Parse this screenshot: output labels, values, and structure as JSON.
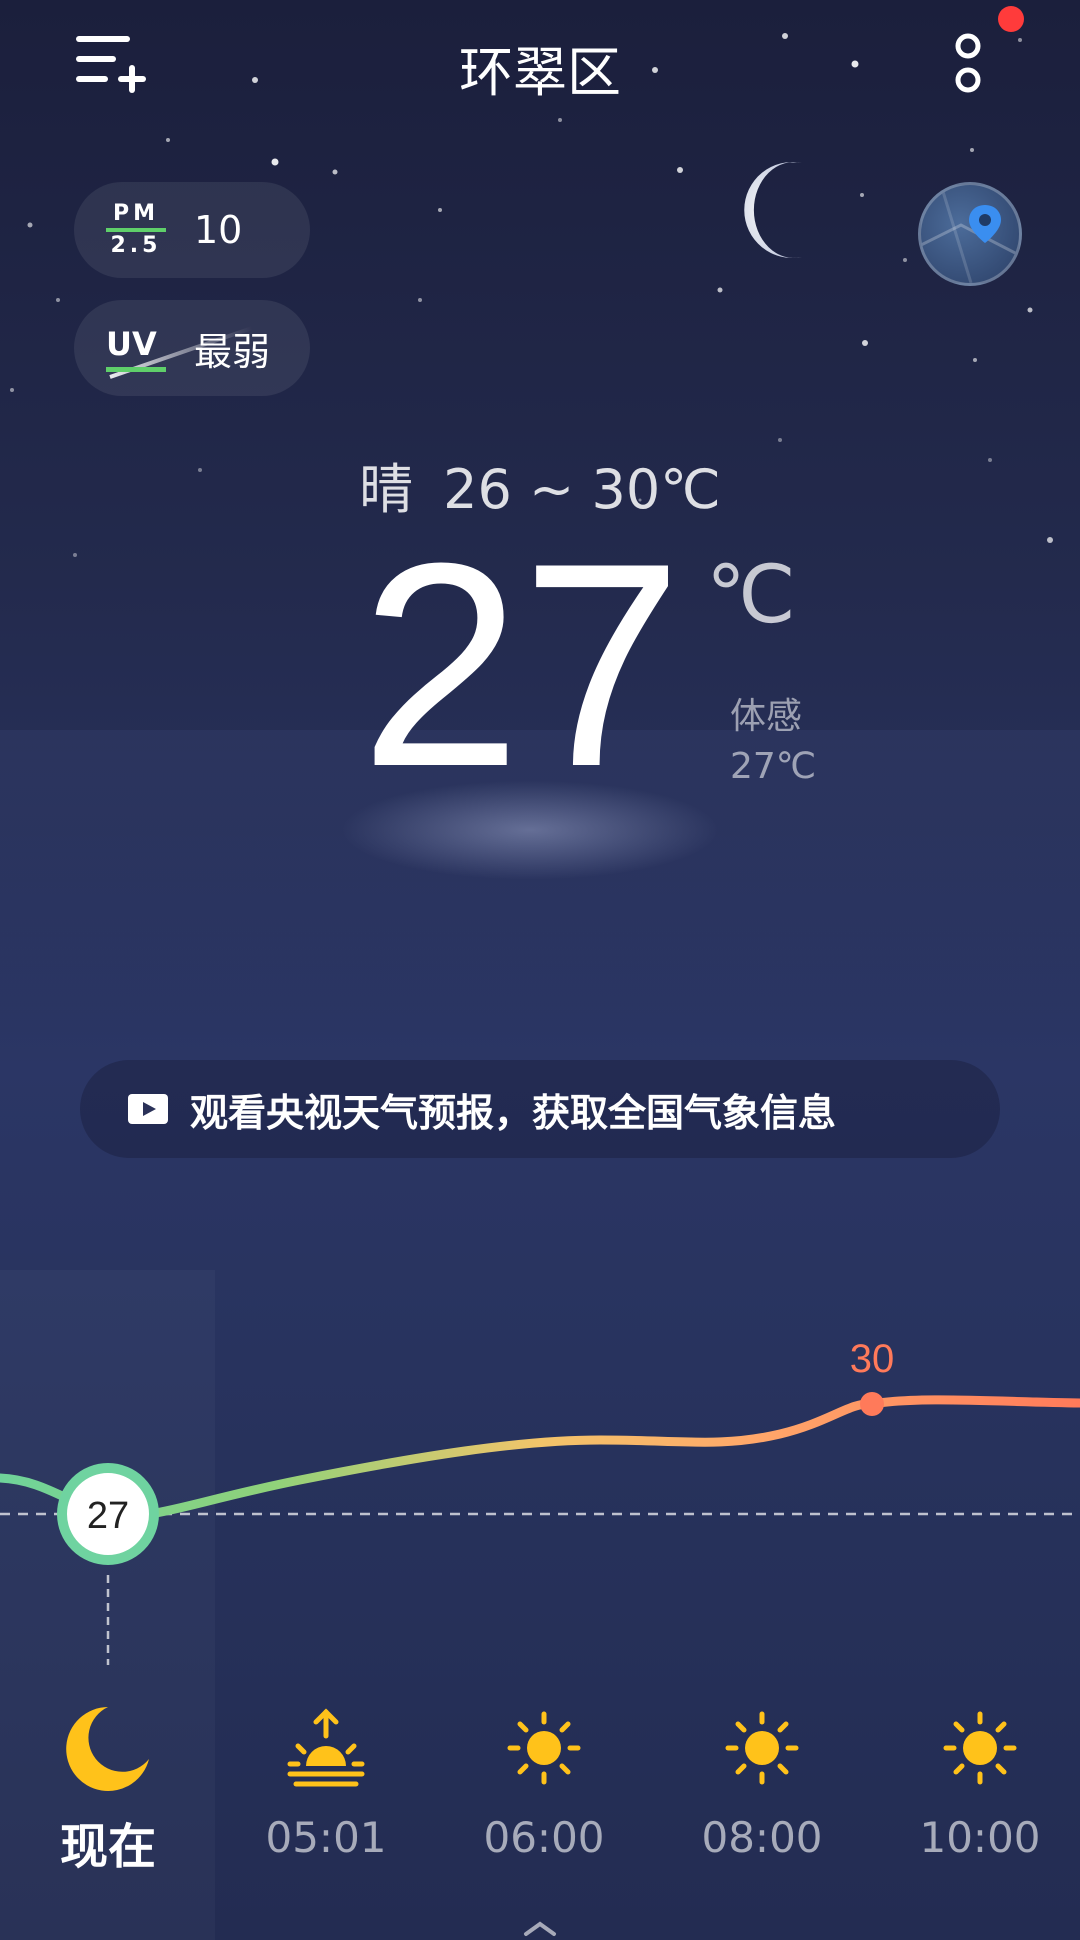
{
  "header": {
    "city": "环翠区",
    "menu_icon": "menu-add-icon",
    "more_icon": "more-vertical-icon",
    "notification_dot_color": "#ff3b3b"
  },
  "air": {
    "pm25_label_top": "PM",
    "pm25_label_bottom": "2.5",
    "pm25_value": "10",
    "uv_label": "UV",
    "uv_value": "最弱"
  },
  "current": {
    "condition": "晴",
    "range": "26 ~ 30℃",
    "temperature": "27",
    "unit": "℃",
    "feels_label": "体感",
    "feels_value": "27℃"
  },
  "promo": {
    "text": "观看央视天气预报，获取全国气象信息",
    "icon": "play-video-icon"
  },
  "hourly_chart": {
    "now_value": "27",
    "max_value": "30",
    "start_color": "#6fd39a",
    "end_color": "#ff7a5a"
  },
  "hourly": [
    {
      "label": "现在",
      "icon": "crescent-moon-icon"
    },
    {
      "label": "05:01",
      "icon": "sunrise-icon"
    },
    {
      "label": "06:00",
      "icon": "sun-icon"
    },
    {
      "label": "08:00",
      "icon": "sun-icon"
    },
    {
      "label": "10:00",
      "icon": "sun-icon"
    }
  ]
}
